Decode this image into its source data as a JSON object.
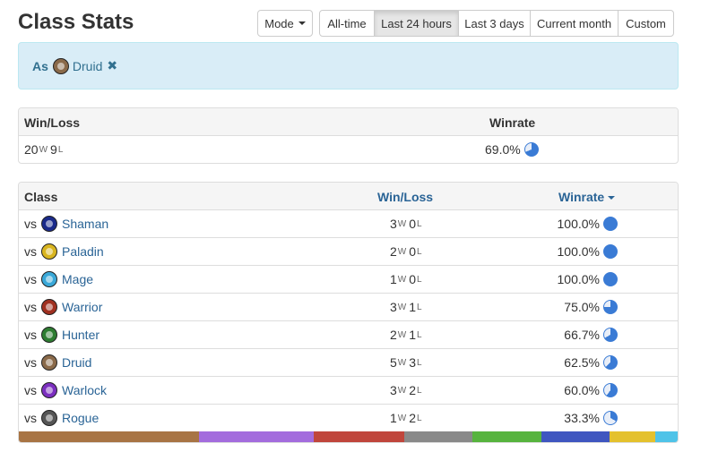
{
  "header": {
    "title": "Class Stats",
    "mode_label": "Mode"
  },
  "time_ranges": [
    {
      "label": "All-time",
      "active": false,
      "width": 62
    },
    {
      "label": "Last 24 hours",
      "active": true,
      "width": 95
    },
    {
      "label": "Last 3 days",
      "active": false,
      "width": 81
    },
    {
      "label": "Current month",
      "active": false,
      "width": 99
    },
    {
      "label": "Custom",
      "active": false,
      "width": 63
    }
  ],
  "filter": {
    "as_label": "As",
    "class_name": "Druid",
    "class_color": "#8a6a4a",
    "remove_glyph": "✖"
  },
  "summary": {
    "header_winloss": "Win/Loss",
    "header_winrate": "Winrate",
    "wins": "20",
    "losses": "9",
    "win_suffix": "W",
    "loss_suffix": "L",
    "winrate": "69.0%",
    "winrate_fraction": 0.69
  },
  "classes_table": {
    "header_class": "Class",
    "header_winloss": "Win/Loss",
    "header_winrate": "Winrate",
    "vs_label": "vs",
    "rows": [
      {
        "name": "Shaman",
        "wins": "3",
        "losses": "0",
        "winrate": "100.0%",
        "fraction": 1.0,
        "icon_color": "#1a2a8a"
      },
      {
        "name": "Paladin",
        "wins": "2",
        "losses": "0",
        "winrate": "100.0%",
        "fraction": 1.0,
        "icon_color": "#d9b520"
      },
      {
        "name": "Mage",
        "wins": "1",
        "losses": "0",
        "winrate": "100.0%",
        "fraction": 1.0,
        "icon_color": "#3aa8d8"
      },
      {
        "name": "Warrior",
        "wins": "3",
        "losses": "1",
        "winrate": "75.0%",
        "fraction": 0.75,
        "icon_color": "#a03020"
      },
      {
        "name": "Hunter",
        "wins": "2",
        "losses": "1",
        "winrate": "66.7%",
        "fraction": 0.667,
        "icon_color": "#2e7d32"
      },
      {
        "name": "Druid",
        "wins": "5",
        "losses": "3",
        "winrate": "62.5%",
        "fraction": 0.625,
        "icon_color": "#8a6a4a"
      },
      {
        "name": "Warlock",
        "wins": "3",
        "losses": "2",
        "winrate": "60.0%",
        "fraction": 0.6,
        "icon_color": "#7b2fbf"
      },
      {
        "name": "Rogue",
        "wins": "1",
        "losses": "2",
        "winrate": "33.3%",
        "fraction": 0.333,
        "icon_color": "#555"
      }
    ]
  },
  "color_bar": [
    {
      "color": "#a87444",
      "share": 27.4
    },
    {
      "color": "#a36cdd",
      "share": 17.4
    },
    {
      "color": "#c0463c",
      "share": 13.7
    },
    {
      "color": "#898989",
      "share": 10.4
    },
    {
      "color": "#57b43e",
      "share": 10.4
    },
    {
      "color": "#3f56c0",
      "share": 10.4
    },
    {
      "color": "#e4c12d",
      "share": 6.9
    },
    {
      "color": "#4fc3e8",
      "share": 3.4
    }
  ]
}
